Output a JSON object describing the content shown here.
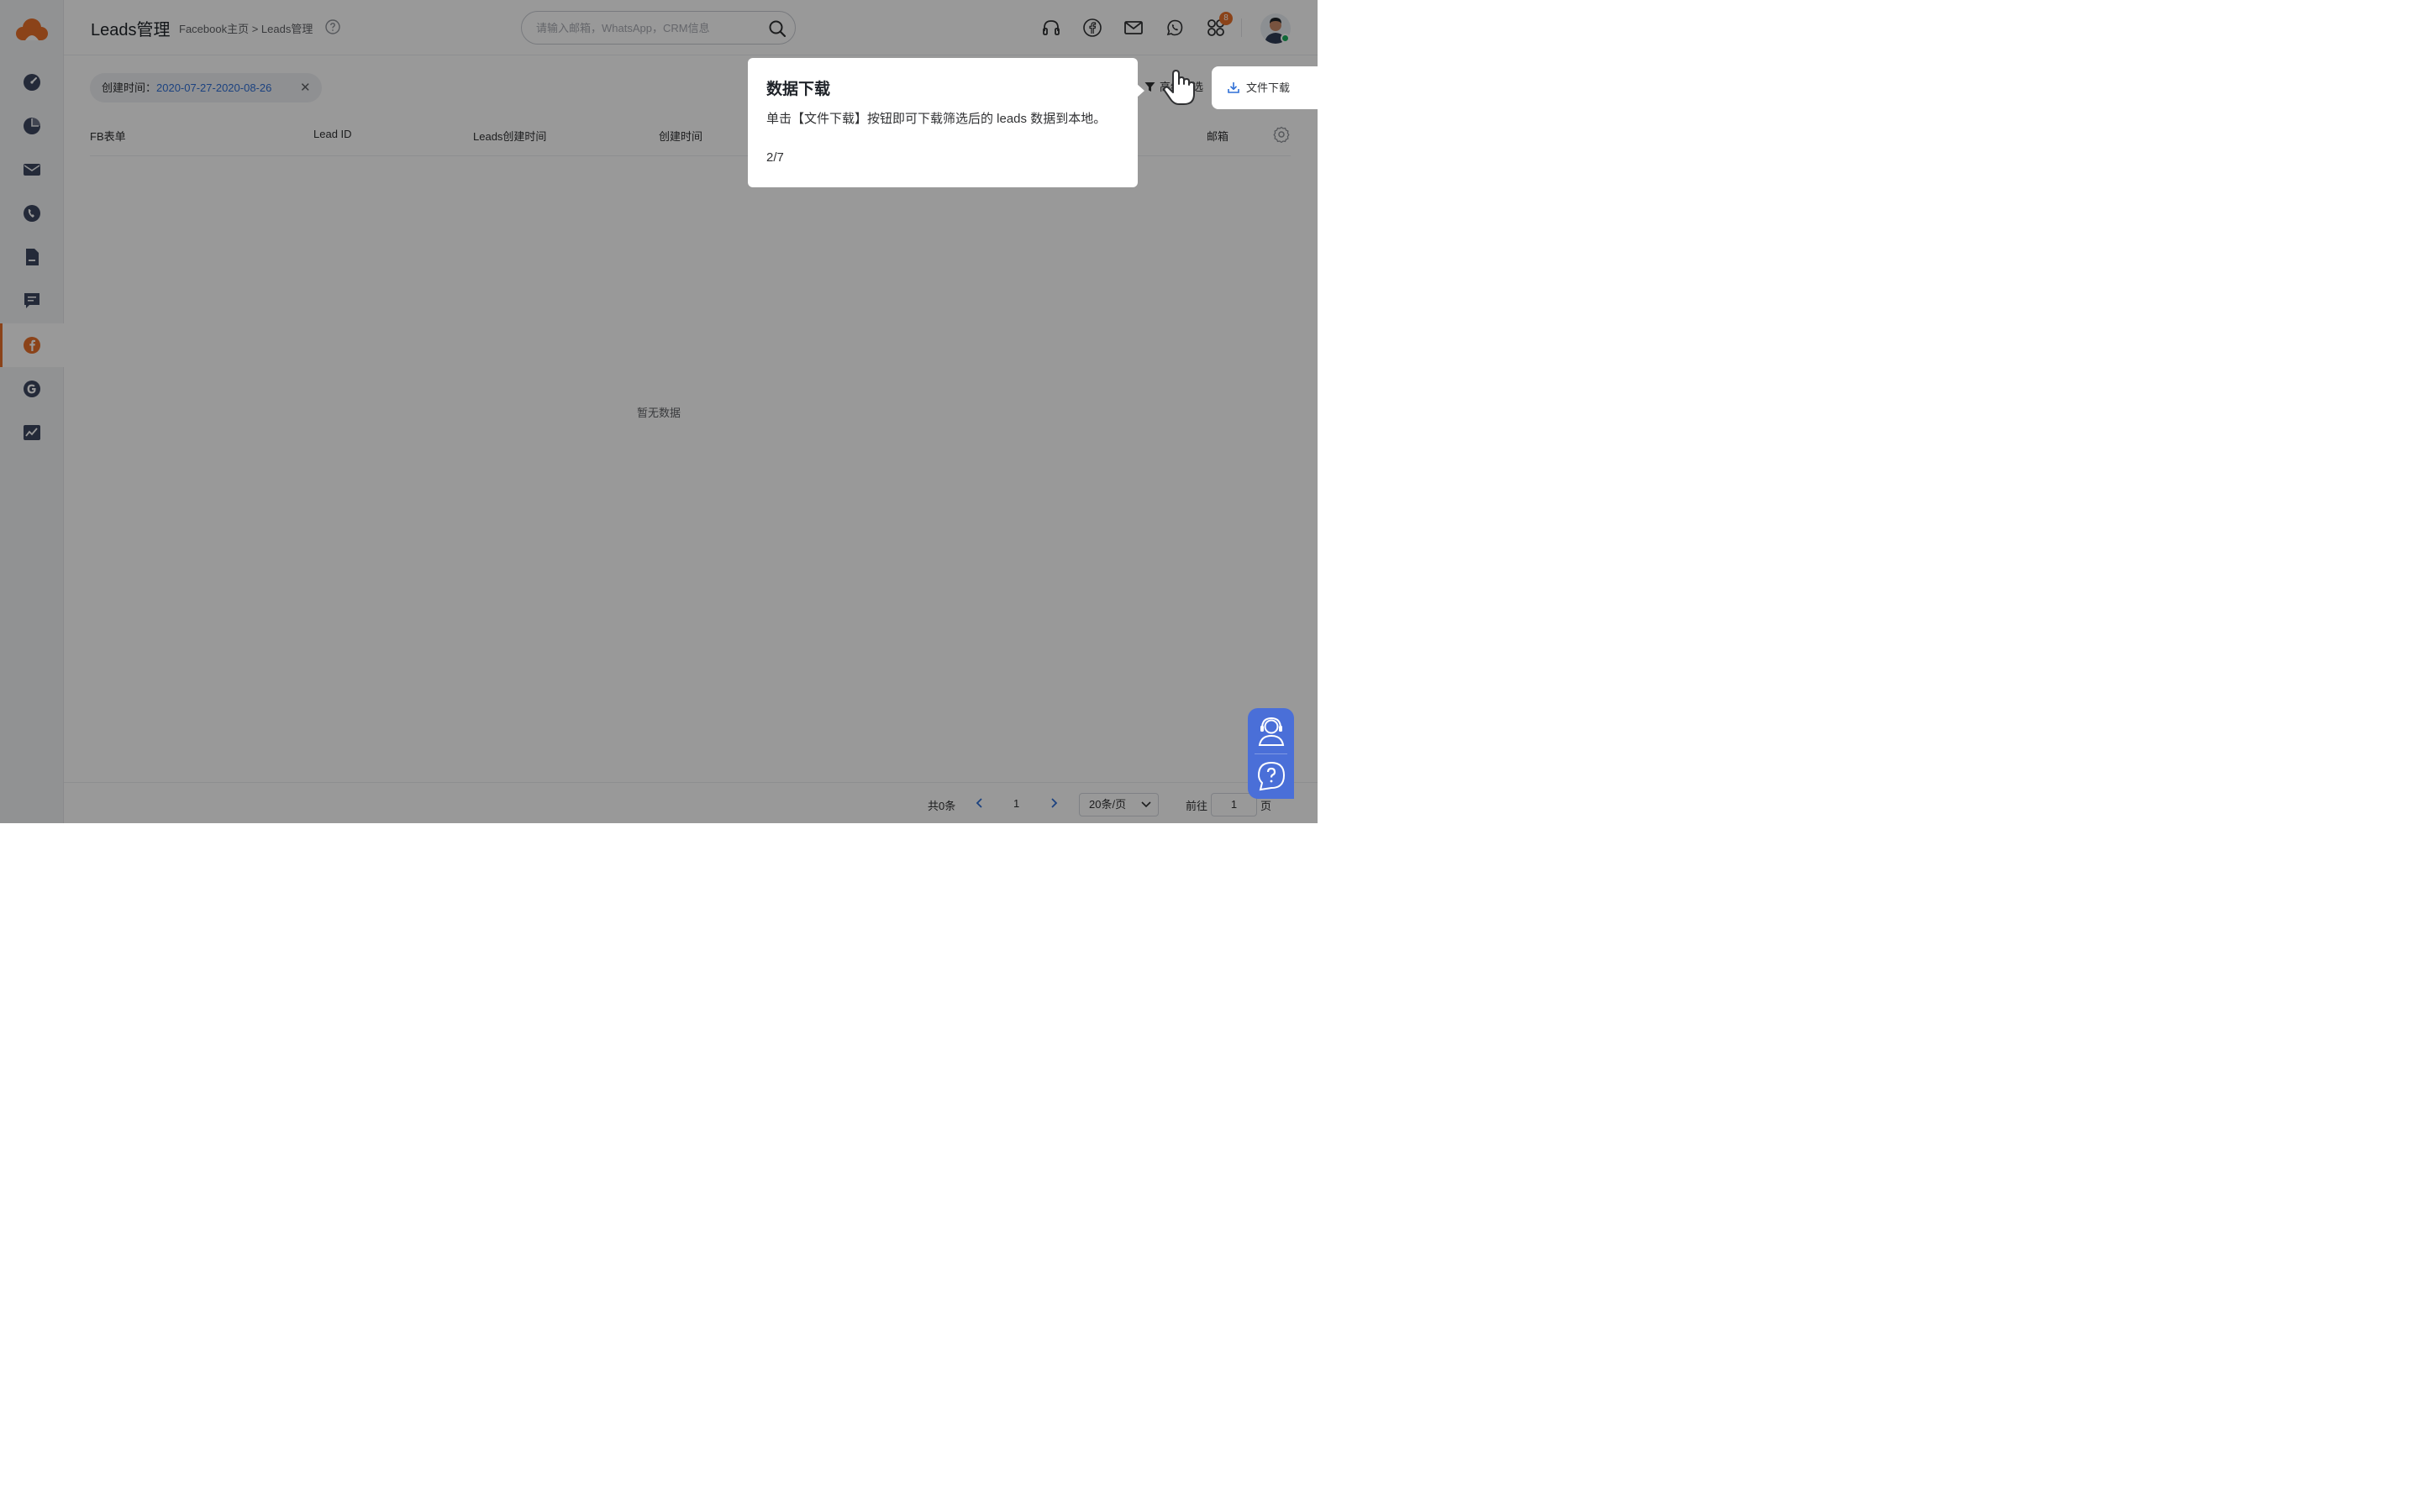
{
  "app": {
    "title": "Leads管理"
  },
  "breadcrumb": "Facebook主页 > Leads管理",
  "search": {
    "placeholder": "请输入邮箱，WhatsApp，CRM信息"
  },
  "header": {
    "notification_count": "8"
  },
  "sidebar": {
    "items": [
      {
        "icon": "dashboard-icon"
      },
      {
        "icon": "pie-chart-icon"
      },
      {
        "icon": "mail-icon"
      },
      {
        "icon": "phone-icon"
      },
      {
        "icon": "file-icon"
      },
      {
        "icon": "message-icon"
      },
      {
        "icon": "facebook-icon",
        "active": true
      },
      {
        "icon": "google-icon"
      },
      {
        "icon": "analytics-icon"
      }
    ]
  },
  "filter": {
    "label": "创建时间：",
    "value": "2020-07-27-2020-08-26"
  },
  "toolbar": {
    "filter_label": "高级筛选",
    "download_label": "文件下载"
  },
  "table": {
    "columns": [
      "FB表单",
      "Lead ID",
      "Leads创建时间",
      "创建时间",
      "邮箱"
    ],
    "empty_text": "暂无数据"
  },
  "pagination": {
    "total": "共0条",
    "current_page": "1",
    "page_size": "20条/页",
    "goto_label": "前往",
    "goto_value": "1",
    "goto_suffix": "页"
  },
  "tour": {
    "title": "数据下载",
    "description": "单击【文件下载】按钮即可下载筛选后的 leads 数据到本地。",
    "step": "2/7"
  },
  "colors": {
    "brand": "#e8702a",
    "link": "#2f6fd6",
    "support": "#4a6fd8"
  }
}
